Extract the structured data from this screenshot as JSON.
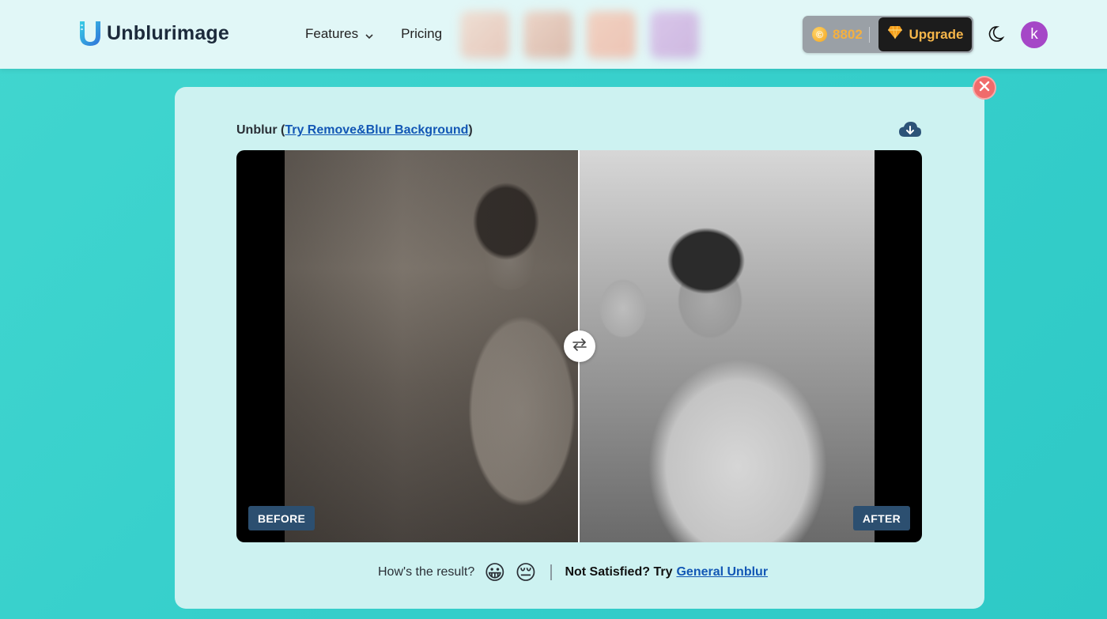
{
  "header": {
    "logo_text": "Unblurimage",
    "nav": {
      "features_label": "Features",
      "pricing_label": "Pricing"
    },
    "credits_count": "8802",
    "upgrade_label": "Upgrade",
    "avatar_initial": "k"
  },
  "modal": {
    "title_prefix": "Unblur (",
    "title_link": "Try Remove&Blur Background",
    "title_suffix": ")",
    "before_label": "BEFORE",
    "after_label": "AFTER",
    "feedback_question": "How's the result?",
    "feedback_good_emoji": "😀",
    "feedback_bad_emoji": "😔",
    "not_satisfied_text": "Not Satisfied? Try",
    "general_unblur_link": "General Unblur"
  },
  "colors": {
    "background": "#36cfcb",
    "header_bg": "#e1f7f7",
    "modal_bg": "#cdf2f1",
    "link": "#1257b5",
    "tag_bg": "#2c4f70",
    "upgrade_bg": "#1c1c1c",
    "upgrade_text": "#f6b64a",
    "avatar_bg": "#a547c7",
    "close_bg": "#f06b6b"
  },
  "icons": [
    "logo-icon",
    "chevron-down-icon",
    "coin-icon",
    "diamond-icon",
    "moon-icon",
    "close-icon",
    "cloud-download-icon",
    "swap-arrows-icon"
  ]
}
